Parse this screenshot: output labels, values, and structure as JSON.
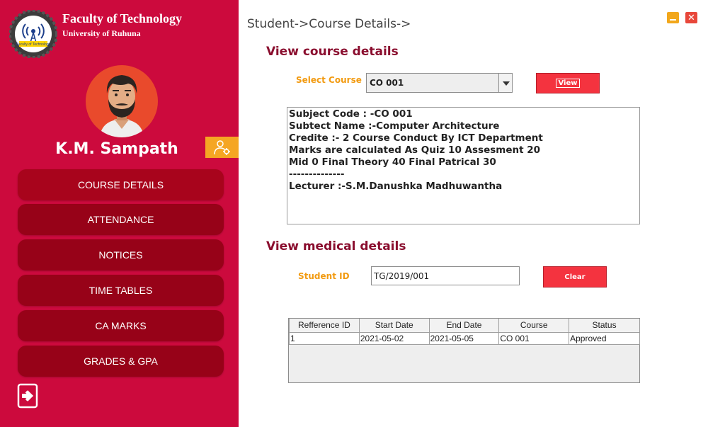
{
  "app": {
    "faculty_title": "Faculty of Technology",
    "faculty_subtitle": "University of Ruhuna",
    "logo_text": "Faculty of Technology"
  },
  "user": {
    "name": "K.M. Sampath"
  },
  "nav": {
    "items": [
      {
        "label": "COURSE DETAILS"
      },
      {
        "label": "ATTENDANCE"
      },
      {
        "label": "NOTICES"
      },
      {
        "label": "TIME TABLES"
      },
      {
        "label": "CA MARKS"
      },
      {
        "label": "GRADES & GPA"
      }
    ]
  },
  "window": {
    "close_glyph": "✕"
  },
  "breadcrumb": "Student->Course Details->",
  "course_section": {
    "title": "View course details",
    "select_label": "Select Course",
    "selected_course": "CO 001",
    "view_button": "View",
    "info_lines": [
      "Subject Code : -CO 001",
      "Subtect Name :-Computer Architecture",
      "Credite :- 2 Course Conduct By ICT Department",
      "Marks are calculated As Quiz 10 Assesment 20",
      "Mid 0 Final Theory 40 Final Patrical 30",
      "--------------",
      "Lecturer :-S.M.Danushka Madhuwantha"
    ]
  },
  "medical_section": {
    "title": "View medical details",
    "student_id_label": "Student ID",
    "student_id_value": "TG/2019/001",
    "clear_button": "Clear",
    "table": {
      "columns": [
        "Refference ID",
        "Start Date",
        "End Date",
        "Course",
        "Status"
      ],
      "rows": [
        [
          "1",
          "2021-05-02",
          "2021-05-05",
          "CO 001",
          "Approved"
        ]
      ]
    }
  },
  "colors": {
    "sidebar": "#cc0a3d",
    "nav_button": "#970218",
    "accent_orange": "#f29b12",
    "section_title": "#8a0d2e",
    "action_button": "#f4333f"
  },
  "icons": {
    "logo": "faculty-logo-icon",
    "settings": "user-settings-icon",
    "logout": "logout-icon",
    "minimize": "minimize-icon",
    "close": "close-icon"
  }
}
